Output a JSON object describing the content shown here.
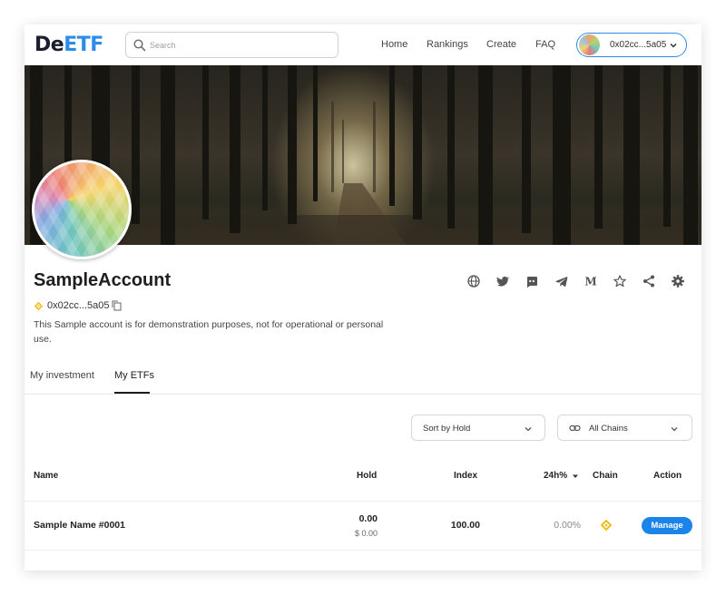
{
  "header": {
    "logo_de": "De",
    "logo_etf": "ETF",
    "search_placeholder": "Search",
    "nav": [
      "Home",
      "Rankings",
      "Create",
      "FAQ"
    ],
    "wallet_address": "0x02cc...5a05"
  },
  "profile": {
    "name": "SampleAccount",
    "address": "0x02cc...5a05",
    "description": "This Sample account is for demonstration purposes, not for operational or personal use.",
    "social_icons": [
      "globe-icon",
      "twitter-icon",
      "discord-icon",
      "telegram-icon",
      "medium-icon",
      "star-icon",
      "share-icon",
      "gear-icon"
    ]
  },
  "tabs": [
    {
      "label": "My investment",
      "active": false
    },
    {
      "label": "My ETFs",
      "active": true
    }
  ],
  "filters": {
    "sort_label": "Sort by Hold",
    "chain_label": "All Chains"
  },
  "table": {
    "headers": {
      "name": "Name",
      "hold": "Hold",
      "index": "Index",
      "change": "24h%",
      "chain": "Chain",
      "action": "Action"
    },
    "rows": [
      {
        "name": "Sample Name #0001",
        "hold": "0.00",
        "hold_usd": "$ 0.00",
        "index": "100.00",
        "change": "0.00%",
        "chain_icon": "bnb-icon",
        "action": "Manage"
      }
    ]
  },
  "colors": {
    "accent": "#2d8ce9",
    "button": "#1a84e8",
    "bnb": "#f0b90b"
  }
}
